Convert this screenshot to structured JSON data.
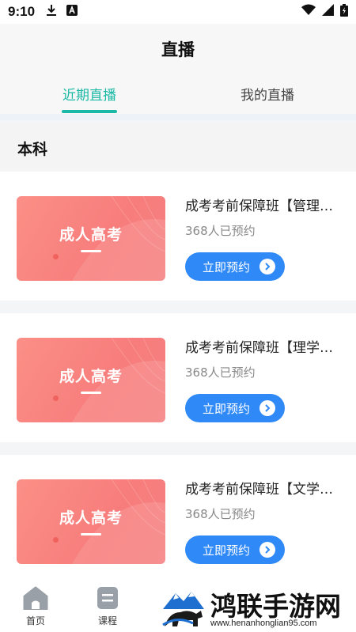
{
  "status_bar": {
    "time": "9:10"
  },
  "header": {
    "title": "直播"
  },
  "tabs": [
    {
      "label": "近期直播",
      "active": true
    },
    {
      "label": "我的直播",
      "active": false
    }
  ],
  "section": {
    "title": "本科"
  },
  "courses": [
    {
      "thumb_text": "成人高考",
      "title": "成考考前保障班【管理…",
      "count": "368人已预约",
      "button": "立即预约"
    },
    {
      "thumb_text": "成人高考",
      "title": "成考考前保障班【理学…",
      "count": "368人已预约",
      "button": "立即预约"
    },
    {
      "thumb_text": "成人高考",
      "title": "成考考前保障班【文学…",
      "count": "368人已预约",
      "button": "立即预约"
    }
  ],
  "tabbar": [
    {
      "label": "首页",
      "icon": "home-icon"
    },
    {
      "label": "课程",
      "icon": "course-icon"
    }
  ],
  "watermark": {
    "text": "鸿联手游网",
    "url": "www.henanhonglian95.com"
  },
  "colors": {
    "accent": "#1bb9a5",
    "button": "#2f89f6",
    "thumb": "#f7807d"
  }
}
